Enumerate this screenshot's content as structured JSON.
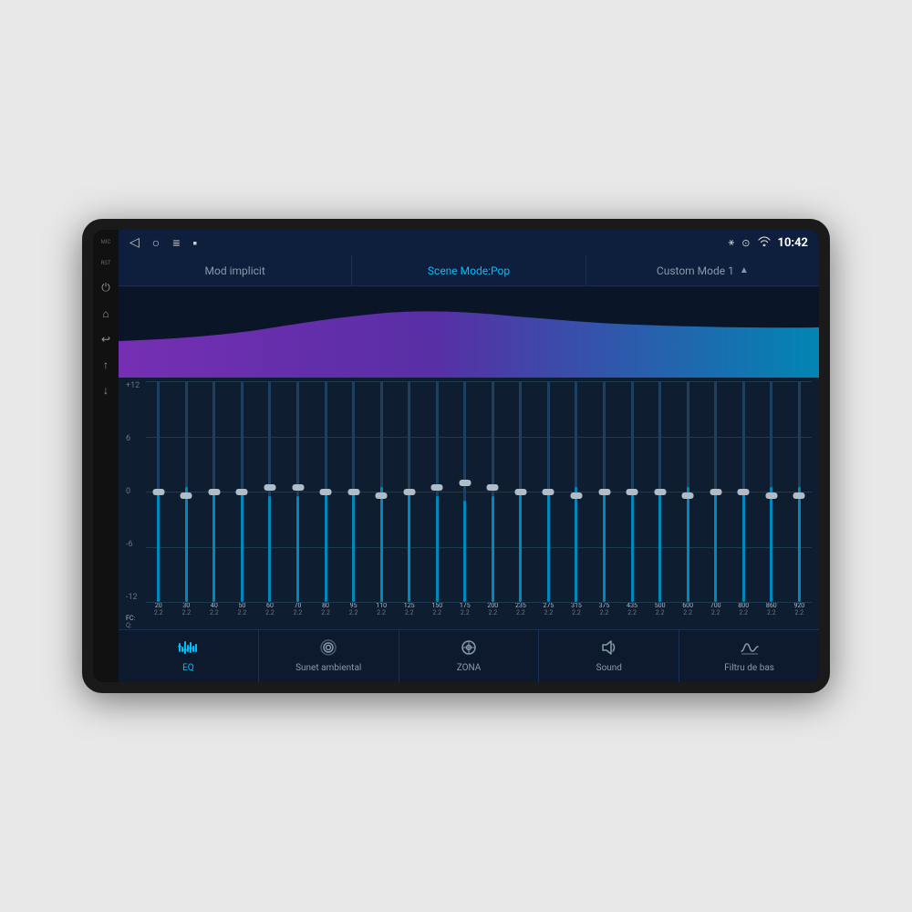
{
  "device": {
    "status_bar": {
      "nav_back": "◁",
      "nav_home": "○",
      "nav_menu": "≡",
      "nav_square": "▪",
      "bluetooth_icon": "⚹",
      "location_icon": "⊙",
      "wifi_icon": "wifi",
      "time": "10:42"
    },
    "mode_tabs": [
      {
        "id": "implicit",
        "label": "Mod implicit",
        "active": false
      },
      {
        "id": "scene",
        "label": "Scene Mode:Pop",
        "active": true
      },
      {
        "id": "custom",
        "label": "Custom Mode 1",
        "active": false,
        "has_triangle": true
      }
    ],
    "eq_scale": {
      "labels": [
        "+12",
        "6",
        "0",
        "-6",
        "-12"
      ]
    },
    "frequencies": [
      {
        "fc": "20",
        "q": "2.2",
        "fill_pct": 55
      },
      {
        "fc": "30",
        "q": "2.2",
        "fill_pct": 52
      },
      {
        "fc": "40",
        "q": "2.2",
        "fill_pct": 52
      },
      {
        "fc": "50",
        "q": "2.2",
        "fill_pct": 52
      },
      {
        "fc": "60",
        "q": "2.2",
        "fill_pct": 52
      },
      {
        "fc": "70",
        "q": "2.2",
        "fill_pct": 52
      },
      {
        "fc": "80",
        "q": "2.2",
        "fill_pct": 52
      },
      {
        "fc": "95",
        "q": "2.2",
        "fill_pct": 52
      },
      {
        "fc": "110",
        "q": "2.2",
        "fill_pct": 52
      },
      {
        "fc": "125",
        "q": "2.2",
        "fill_pct": 52
      },
      {
        "fc": "150",
        "q": "2.2",
        "fill_pct": 52
      },
      {
        "fc": "175",
        "q": "2.2",
        "fill_pct": 52
      },
      {
        "fc": "200",
        "q": "2.2",
        "fill_pct": 52
      },
      {
        "fc": "235",
        "q": "2.2",
        "fill_pct": 52
      },
      {
        "fc": "275",
        "q": "2.2",
        "fill_pct": 52
      },
      {
        "fc": "315",
        "q": "2.2",
        "fill_pct": 52
      },
      {
        "fc": "375",
        "q": "2.2",
        "fill_pct": 52
      },
      {
        "fc": "435",
        "q": "2.2",
        "fill_pct": 52
      },
      {
        "fc": "500",
        "q": "2.2",
        "fill_pct": 52
      },
      {
        "fc": "600",
        "q": "2.2",
        "fill_pct": 52
      },
      {
        "fc": "700",
        "q": "2.2",
        "fill_pct": 52
      },
      {
        "fc": "800",
        "q": "2.2",
        "fill_pct": 52
      },
      {
        "fc": "860",
        "q": "2.2",
        "fill_pct": 52
      },
      {
        "fc": "920",
        "q": "2.2",
        "fill_pct": 52
      }
    ],
    "bottom_nav": [
      {
        "id": "eq",
        "label": "EQ",
        "icon": "eq",
        "active": true
      },
      {
        "id": "ambient",
        "label": "Sunet ambiental",
        "icon": "ambient",
        "active": false
      },
      {
        "id": "zona",
        "label": "ZONA",
        "icon": "zona",
        "active": false
      },
      {
        "id": "sound",
        "label": "Sound",
        "icon": "sound",
        "active": false
      },
      {
        "id": "bass",
        "label": "Filtru de bas",
        "icon": "bass",
        "active": false
      }
    ],
    "side_buttons": {
      "mic_label": "MIC",
      "rst_label": "RST"
    }
  }
}
